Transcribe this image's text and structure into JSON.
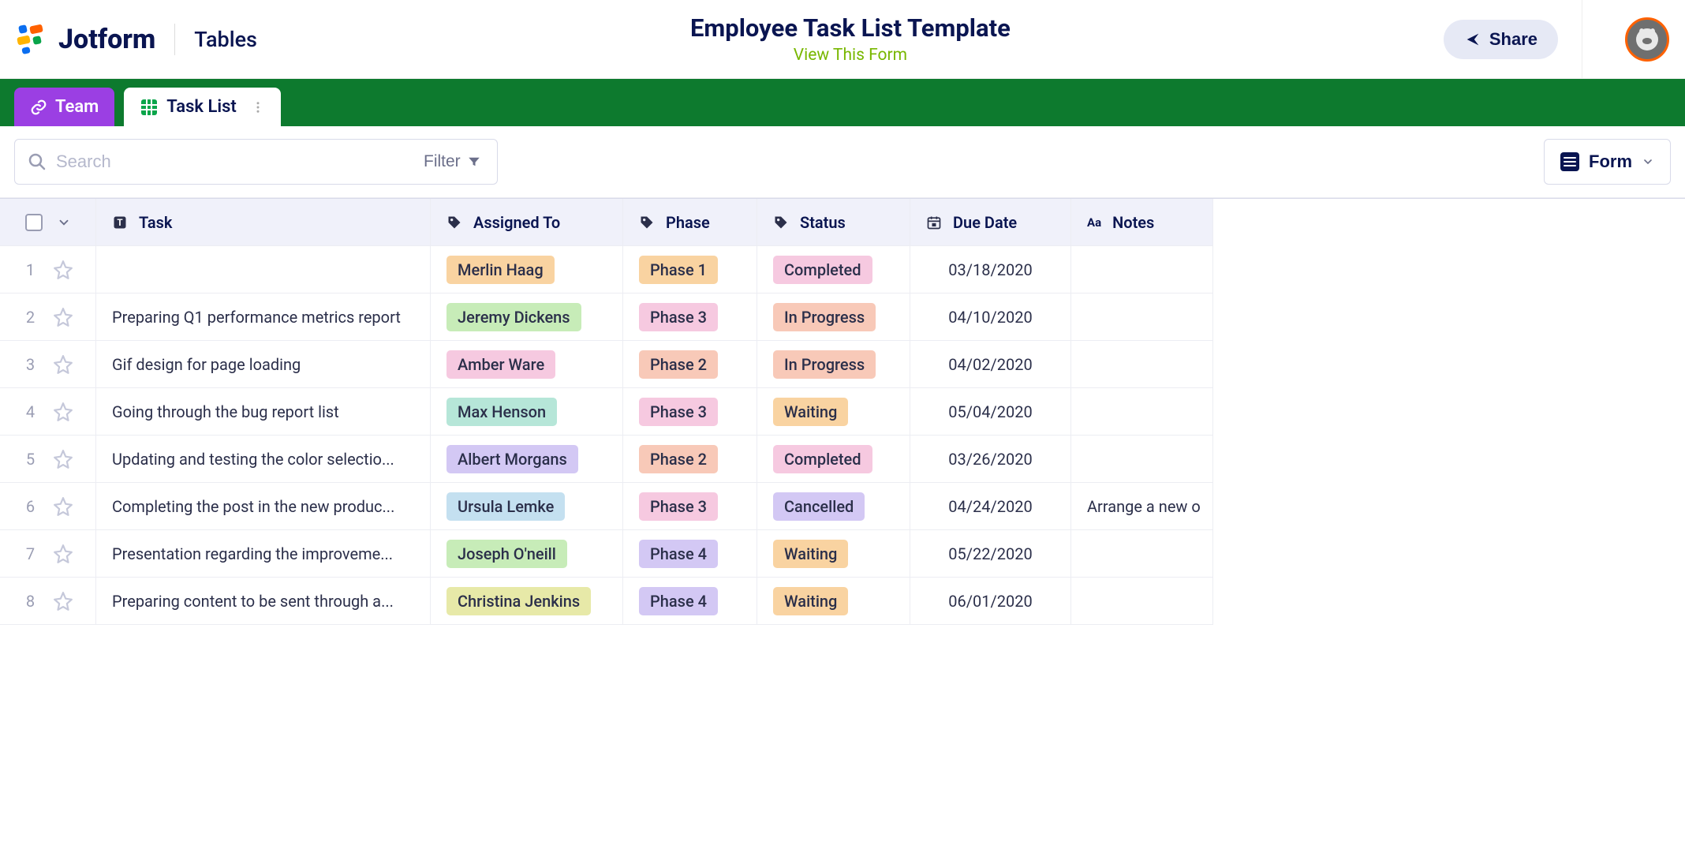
{
  "header": {
    "brand": "Jotform",
    "app": "Tables",
    "title": "Employee Task List Template",
    "subtitle": "View This Form",
    "share": "Share"
  },
  "tabs": {
    "team": "Team",
    "tasklist": "Task List"
  },
  "toolbar": {
    "search_placeholder": "Search",
    "filter": "Filter",
    "form": "Form"
  },
  "columns": {
    "task": "Task",
    "assigned": "Assigned To",
    "phase": "Phase",
    "status": "Status",
    "due": "Due Date",
    "notes": "Notes"
  },
  "rows": [
    {
      "num": "1",
      "task": "",
      "assigned": "Merlin Haag",
      "assigned_c": "c-orange",
      "phase": "Phase 1",
      "phase_c": "c-orange",
      "status": "Completed",
      "status_c": "c-pink",
      "due": "03/18/2020",
      "notes": ""
    },
    {
      "num": "2",
      "task": "Preparing Q1 performance metrics report",
      "assigned": "Jeremy Dickens",
      "assigned_c": "c-green",
      "phase": "Phase 3",
      "phase_c": "c-pink",
      "status": "In Progress",
      "status_c": "c-peach",
      "due": "04/10/2020",
      "notes": ""
    },
    {
      "num": "3",
      "task": "Gif design for page loading",
      "assigned": "Amber Ware",
      "assigned_c": "c-pink",
      "phase": "Phase 2",
      "phase_c": "c-peach",
      "status": "In Progress",
      "status_c": "c-peach",
      "due": "04/02/2020",
      "notes": ""
    },
    {
      "num": "4",
      "task": "Going through the bug report list",
      "assigned": "Max Henson",
      "assigned_c": "c-teal",
      "phase": "Phase 3",
      "phase_c": "c-pink",
      "status": "Waiting",
      "status_c": "c-orange",
      "due": "05/04/2020",
      "notes": ""
    },
    {
      "num": "5",
      "task": "Updating and testing the color selectio...",
      "assigned": "Albert Morgans",
      "assigned_c": "c-purple",
      "phase": "Phase 2",
      "phase_c": "c-peach",
      "status": "Completed",
      "status_c": "c-pink",
      "due": "03/26/2020",
      "notes": ""
    },
    {
      "num": "6",
      "task": "Completing the post in the new produc...",
      "assigned": "Ursula Lemke",
      "assigned_c": "c-blue",
      "phase": "Phase 3",
      "phase_c": "c-pink",
      "status": "Cancelled",
      "status_c": "c-purple",
      "due": "04/24/2020",
      "notes": "Arrange a new o"
    },
    {
      "num": "7",
      "task": "Presentation regarding the improveme...",
      "assigned": "Joseph O'neill",
      "assigned_c": "c-green",
      "phase": "Phase 4",
      "phase_c": "c-purple",
      "status": "Waiting",
      "status_c": "c-orange",
      "due": "05/22/2020",
      "notes": ""
    },
    {
      "num": "8",
      "task": "Preparing content to be sent through a...",
      "assigned": "Christina Jenkins",
      "assigned_c": "c-lime",
      "phase": "Phase 4",
      "phase_c": "c-purple",
      "status": "Waiting",
      "status_c": "c-orange",
      "due": "06/01/2020",
      "notes": ""
    }
  ]
}
